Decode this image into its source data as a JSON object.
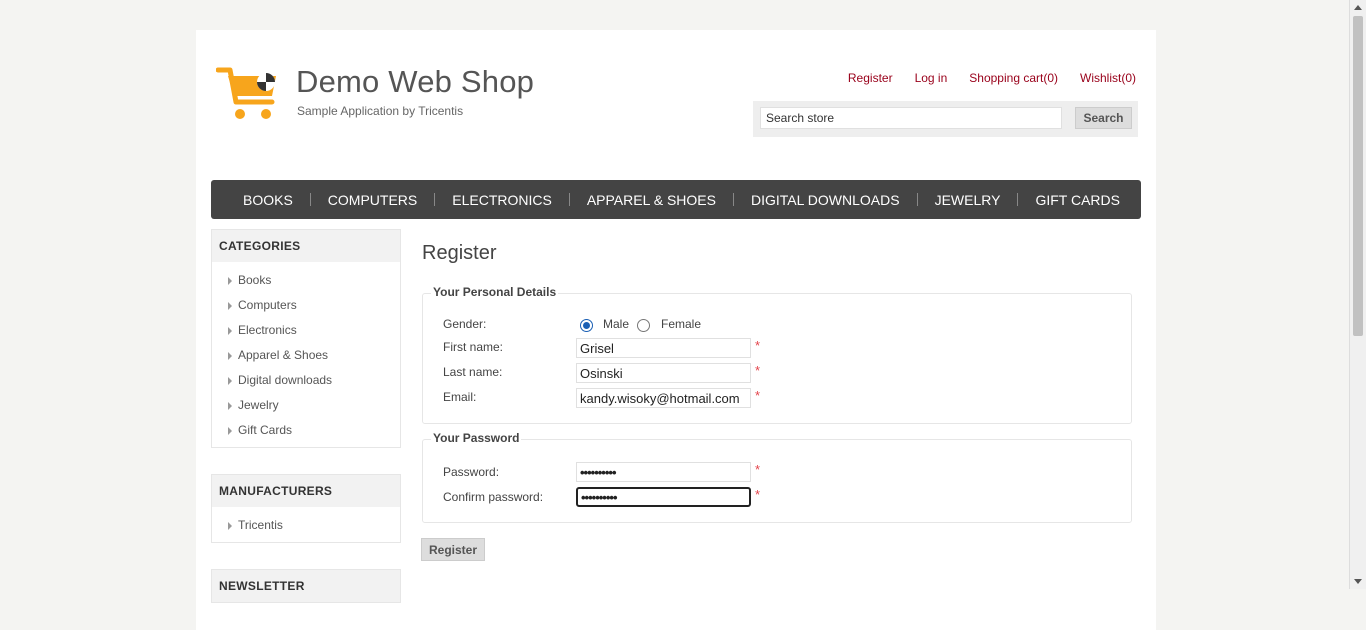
{
  "header": {
    "title": "Demo Web Shop",
    "subtitle": "Sample Application by Tricentis",
    "links": {
      "register": "Register",
      "login": "Log in",
      "cart": "Shopping cart(0)",
      "wishlist": "Wishlist(0)"
    },
    "search": {
      "value": "Search store",
      "button": "Search"
    }
  },
  "top_menu": [
    "BOOKS",
    "COMPUTERS",
    "ELECTRONICS",
    "APPAREL & SHOES",
    "DIGITAL DOWNLOADS",
    "JEWELRY",
    "GIFT CARDS"
  ],
  "categories": {
    "title": "CATEGORIES",
    "items": [
      "Books",
      "Computers",
      "Electronics",
      "Apparel & Shoes",
      "Digital downloads",
      "Jewelry",
      "Gift Cards"
    ]
  },
  "manufacturers": {
    "title": "MANUFACTURERS",
    "items": [
      "Tricentis"
    ]
  },
  "newsletter": {
    "title": "NEWSLETTER"
  },
  "main": {
    "title": "Register",
    "personal": {
      "legend": "Your Personal Details",
      "gender_label": "Gender:",
      "male": "Male",
      "female": "Female",
      "first_name_label": "First name:",
      "first_name": "Grisel",
      "last_name_label": "Last name:",
      "last_name": "Osinski",
      "email_label": "Email:",
      "email": "kandy.wisoky@hotmail.com"
    },
    "password": {
      "legend": "Your Password",
      "password_label": "Password:",
      "password_value": "••••••••••",
      "confirm_label": "Confirm password:",
      "confirm_value": "••••••••••"
    },
    "required_mark": "*",
    "register_button": "Register"
  },
  "colors": {
    "link": "#99001a",
    "menu_bg": "#444444",
    "required": "#e4434b",
    "logo": "#f7a51c"
  },
  "icons": {
    "logo": "shopping-cart-icon"
  }
}
